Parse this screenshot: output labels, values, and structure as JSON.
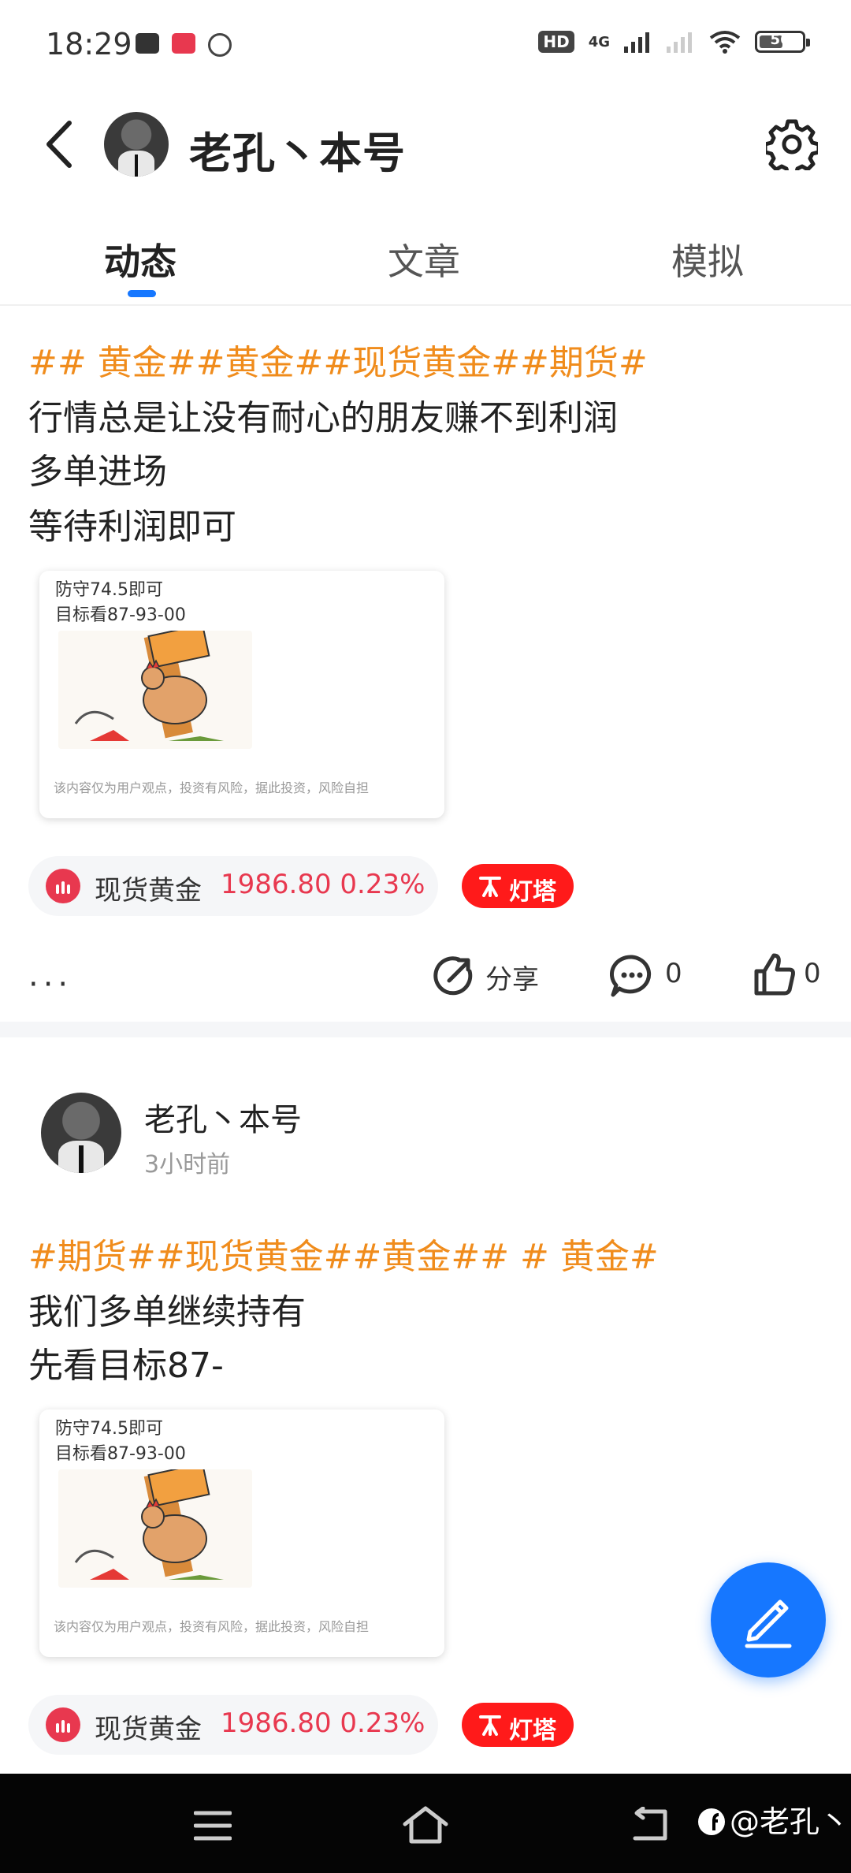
{
  "status_bar": {
    "time": "18:29",
    "app_icons": [
      "toutiao-icon",
      "app-icon",
      "assistant-icon"
    ],
    "network_label": "4G",
    "hd_label": "HD",
    "battery": "56"
  },
  "header": {
    "title": "老孔丶本号"
  },
  "tabs": [
    {
      "label": "动态",
      "active": true
    },
    {
      "label": "文章",
      "active": false
    },
    {
      "label": "模拟",
      "active": false
    }
  ],
  "posts": [
    {
      "tags": "## 黄金##黄金##现货黄金##期货#",
      "lines": [
        "行情总是让没有耐心的朋友赚不到利润",
        "多单进场",
        "等待利润即可"
      ],
      "card": {
        "line1": "防守74.5即可",
        "line2": "目标看87-93-00",
        "disclaimer": "该内容仅为用户观点，投资有风险，据此投资，风险自担"
      },
      "quote": {
        "name": "现货黄金",
        "price": "1986.80 0.23%"
      },
      "badge": "灯塔",
      "actions": {
        "share": "分享",
        "comments": "0",
        "likes": "0"
      }
    },
    {
      "author": "老孔丶本号",
      "time": "3小时前",
      "tags": "#期货##现货黄金##黄金## # 黄金#",
      "lines": [
        "我们多单继续持有",
        "先看目标87-"
      ],
      "card": {
        "line1": "防守74.5即可",
        "line2": "目标看87-93-00",
        "disclaimer": "该内容仅为用户观点，投资有风险，据此投资，风险自担"
      },
      "quote": {
        "name": "现货黄金",
        "price": "1986.80 0.23%"
      },
      "badge": "灯塔"
    }
  ],
  "watermark": "@老孔丶",
  "colors": {
    "accent": "#1677ff",
    "tag": "#f08c1c",
    "price": "#e8384f",
    "badge": "#ff1a1a"
  }
}
